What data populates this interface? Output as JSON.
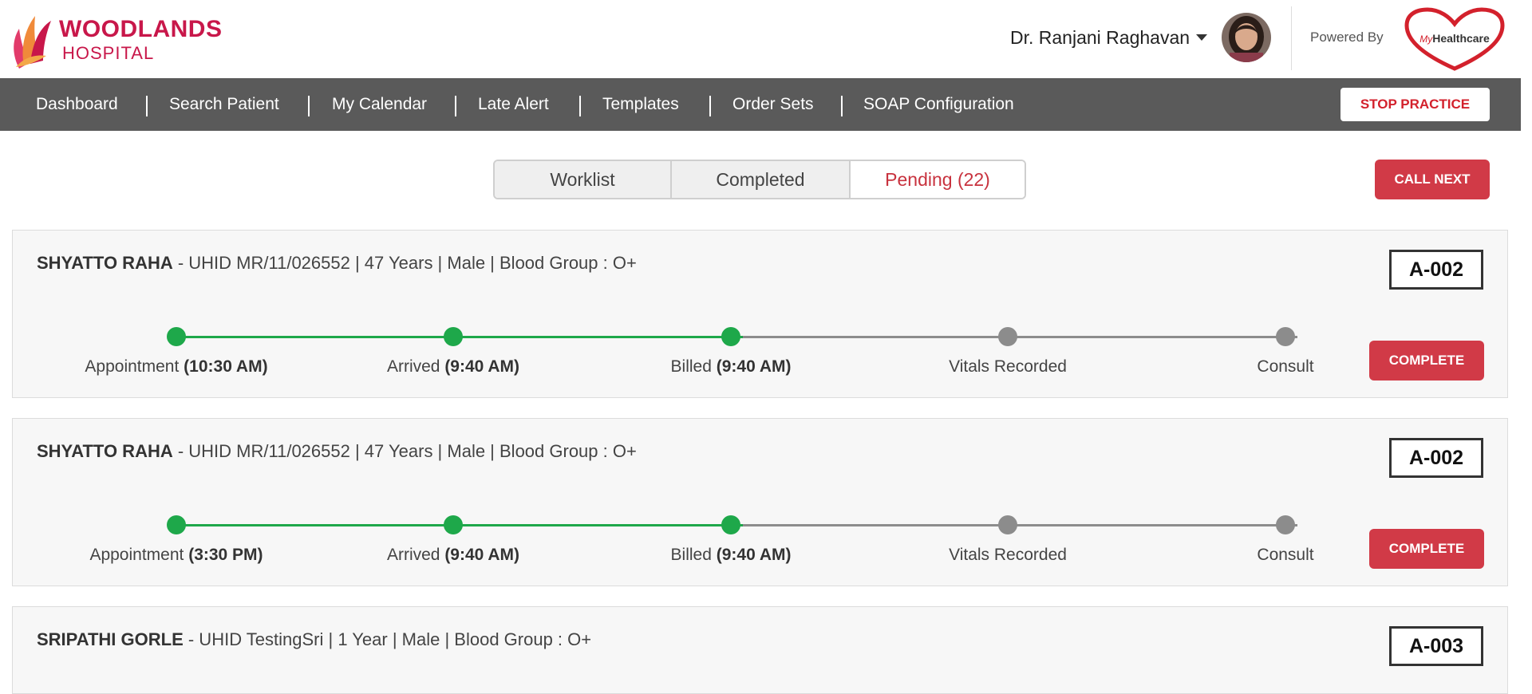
{
  "header": {
    "logo_line1": "WOODLANDS",
    "logo_line2": "HOSPITAL",
    "user_name": "Dr. Ranjani Raghavan",
    "powered_by": "Powered By",
    "brand_my": "My",
    "brand_name": "Healthcare"
  },
  "nav": {
    "items": [
      "Dashboard",
      "Search Patient",
      "My Calendar",
      "Late Alert",
      "Templates",
      "Order Sets",
      "SOAP Configuration"
    ],
    "stop_label": "STOP PRACTICE"
  },
  "tabs": {
    "items": [
      "Worklist",
      "Completed",
      "Pending (22)"
    ],
    "active_index": 2
  },
  "call_next_label": "CALL NEXT",
  "cards": [
    {
      "name": "SHYATTO RAHA",
      "details": " - UHID MR/11/026552 | 47 Years | Male | Blood Group : O+",
      "token": "A-002",
      "button": "COMPLETE",
      "steps": [
        {
          "label": "Appointment ",
          "time": "(10:30 AM)",
          "done": true
        },
        {
          "label": "Arrived ",
          "time": "(9:40 AM)",
          "done": true
        },
        {
          "label": "Billed ",
          "time": "(9:40 AM)",
          "done": true
        },
        {
          "label": "Vitals Recorded",
          "time": "",
          "done": false
        },
        {
          "label": "Consult",
          "time": "",
          "done": false
        }
      ]
    },
    {
      "name": "SHYATTO RAHA",
      "details": " - UHID MR/11/026552 | 47 Years | Male | Blood Group : O+",
      "token": "A-002",
      "button": "COMPLETE",
      "steps": [
        {
          "label": "Appointment ",
          "time": "(3:30 PM)",
          "done": true
        },
        {
          "label": "Arrived ",
          "time": "(9:40 AM)",
          "done": true
        },
        {
          "label": "Billed ",
          "time": "(9:40 AM)",
          "done": true
        },
        {
          "label": "Vitals Recorded",
          "time": "",
          "done": false
        },
        {
          "label": "Consult",
          "time": "",
          "done": false
        }
      ]
    },
    {
      "name": "SRIPATHI GORLE",
      "details": " - UHID TestingSri | 1 Year | Male | Blood Group : O+",
      "token": "A-003"
    }
  ],
  "colors": {
    "brand": "#c8174a",
    "nav_bg": "#5a5a5a",
    "accent_red": "#d13a47",
    "progress_done": "#1ea84a",
    "progress_pending": "#8c8c8c"
  },
  "icons": {
    "user_menu": "chevron-down-icon",
    "avatar": "user-avatar"
  }
}
